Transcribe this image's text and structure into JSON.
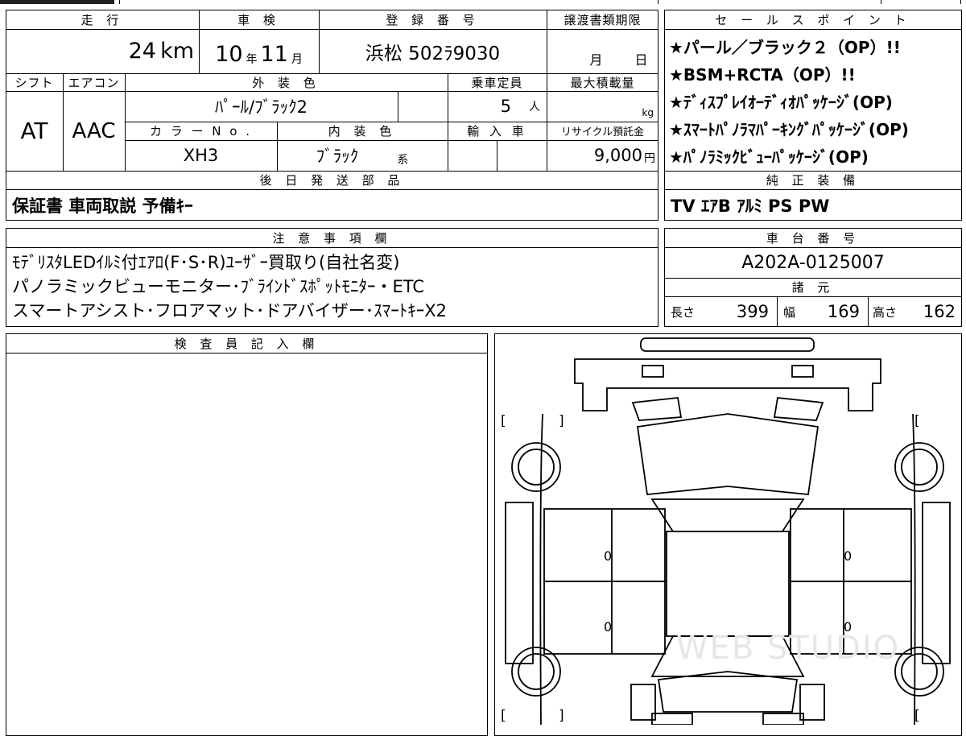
{
  "top_strip": [],
  "headers": {
    "mileage": "走 行",
    "inspection": "車 検",
    "registration": "登 録 番 号",
    "transfer_deadline": "譲渡書類期限",
    "shift": "シフト",
    "aircon": "エアコン",
    "exterior_color": "外 装 色",
    "capacity": "乗車定員",
    "max_load": "最大積載量",
    "color_no": "カ ラ ー N o .",
    "interior_color": "内 装 色",
    "import": "輸 入 車",
    "recycle": "リサイクル預託金",
    "later_items": "後 日 発 送 部 品",
    "sales_points": "セ ー ル ス ポ イ ン ト",
    "genuine_equipment": "純 正 装 備",
    "notes": "注 意 事 項 欄",
    "chassis_no": "車 台 番 号",
    "specs": "諸 元",
    "inspector": "検 査 員 記 入 欄"
  },
  "values": {
    "mileage_num": "24",
    "mileage_unit": "km",
    "inspection_year": "10",
    "year_unit": "年",
    "inspection_month": "11",
    "month_unit": "月",
    "registration": "浜松 502ﾗ9030",
    "deadline_month_unit": "月",
    "deadline_day_unit": "日",
    "shift": "AT",
    "aircon": "AAC",
    "exterior_color": "ﾊﾟｰﾙ/ﾌﾞﾗｯｸ2",
    "capacity_num": "5",
    "capacity_unit": "人",
    "load_unit": "kg",
    "color_no": "XH3",
    "interior_color": "ﾌﾞﾗｯｸ",
    "interior_suffix": "系",
    "recycle_amount": "9,000",
    "recycle_unit": "円",
    "later_items": "保証書 車両取説 予備ｷｰ",
    "chassis_no": "A202A-0125007"
  },
  "sales_points": [
    "★パール／ブラック２（OP）!!",
    "★BSM+RCTA（OP）!!",
    "★ﾃﾞｨｽﾌﾟﾚｲｵｰﾃﾞｨｵﾊﾟｯｹｰｼﾞ(OP)",
    "★ｽﾏｰﾄﾊﾟﾉﾗﾏﾊﾟｰｷﾝｸﾞﾊﾟｯｹｰｼﾞ(OP)",
    "★ﾊﾟﾉﾗﾐｯｸﾋﾞｭｰﾊﾟｯｹｰｼﾞ(OP)"
  ],
  "genuine_equipment": "TV ｴｱB ｱﾙﾐ PS PW",
  "notes": [
    "ﾓﾃﾞﾘｽﾀLEDｲﾙﾐ付ｴｱﾛ(F･S･R)ﾕｰｻﾞｰ買取り(自社名変)",
    "パノラミックビューモニター･ﾌﾞﾗｲﾝﾄﾞｽﾎﾟｯﾄﾓﾆﾀｰ・ETC",
    "スマートアシスト･フロアマット･ドアバイザー･ｽﾏｰﾄｷｰX2"
  ],
  "specs": {
    "length_label": "長さ",
    "length": "399",
    "width_label": "幅",
    "width": "169",
    "height_label": "高さ",
    "height": "162"
  },
  "diagram": {
    "bracket": "[ ]",
    "zero": "0"
  },
  "watermark": "WEB STUDIO"
}
